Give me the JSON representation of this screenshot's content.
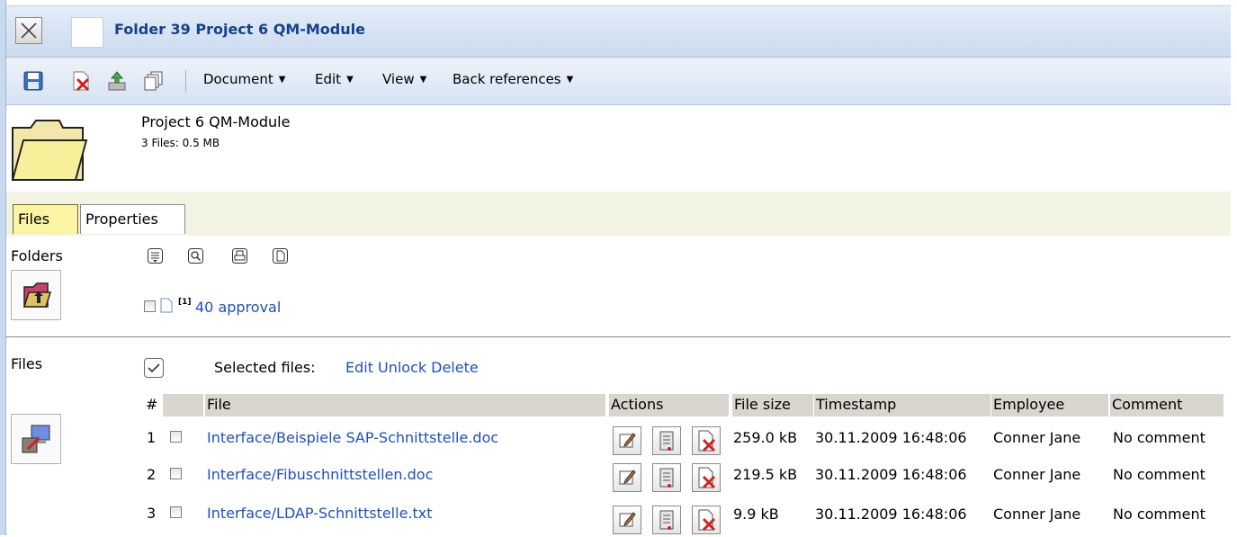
{
  "window": {
    "title": "Folder 39 Project 6 QM-Module"
  },
  "toolbar": {
    "icons": [
      "save-icon",
      "delete-document-icon",
      "upload-icon",
      "copy-icon"
    ],
    "menus": [
      "Document",
      "Edit",
      "View",
      "Back references"
    ]
  },
  "folder": {
    "name": "Project 6 QM-Module",
    "info": "3 Files: 0.5 MB"
  },
  "tabs": [
    {
      "label": "Files",
      "active": true
    },
    {
      "label": "Properties",
      "active": false
    }
  ],
  "folders_section": {
    "label": "Folders",
    "tools": [
      "list-icon",
      "search-icon",
      "print-icon",
      "document-icon"
    ],
    "items": [
      {
        "badge": "[1]",
        "name": "40 approval"
      }
    ]
  },
  "files_section": {
    "label": "Files",
    "selected_label": "Selected files:",
    "selected_actions": [
      "Edit",
      "Unlock",
      "Delete"
    ],
    "columns": [
      "#",
      "File",
      "Actions",
      "File size",
      "Timestamp",
      "Employee",
      "Comment"
    ],
    "rows": [
      {
        "num": "1",
        "file": "Interface/Beispiele SAP-Schnittstelle.doc",
        "size": "259.0 kB",
        "timestamp": "30.11.2009 16:48:06",
        "employee": "Conner Jane",
        "comment": "No comment"
      },
      {
        "num": "2",
        "file": "Interface/Fibuschnittstellen.doc",
        "size": "219.5 kB",
        "timestamp": "30.11.2009 16:48:06",
        "employee": "Conner Jane",
        "comment": "No comment"
      },
      {
        "num": "3",
        "file": "Interface/LDAP-Schnittstelle.txt",
        "size": "9.9 kB",
        "timestamp": "30.11.2009 16:48:06",
        "employee": "Conner Jane",
        "comment": "No comment"
      }
    ]
  },
  "colors": {
    "title_text": "#15428b",
    "link": "#1f4fc0",
    "active_tab": "#fbf4a4"
  }
}
